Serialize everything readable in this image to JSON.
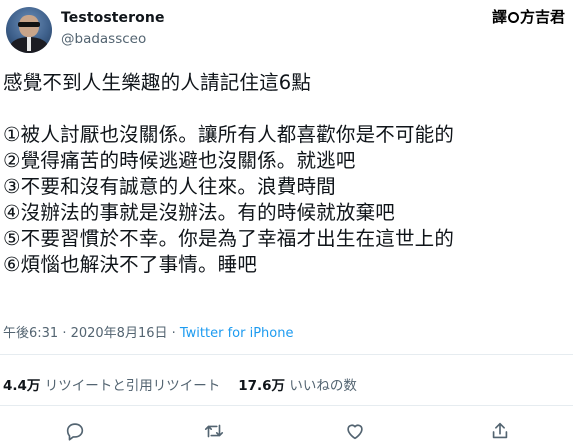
{
  "tweet": {
    "display_name": "Testosterone",
    "handle": "@badassceo",
    "watermark": {
      "left": "譯",
      "right": "方吉君"
    },
    "lines": [
      "感覺不到人生樂趣的人請記住這6點",
      "",
      "①被人討厭也沒關係。讓所有人都喜歡你是不可能的",
      "②覺得痛苦的時候逃避也沒關係。就逃吧",
      "③不要和沒有誠意的人往來。浪費時間",
      "④沒辦法的事就是沒辦法。有的時候就放棄吧",
      "⑤不要習慣於不幸。你是為了幸福才出生在這世上的",
      "⑥煩惱也解決不了事情。睡吧"
    ],
    "timestamp": "午後6:31 · 2020年8月16日 · ",
    "source": "Twitter for iPhone",
    "retweets_count": "4.4万",
    "retweets_label": "リツイートと引用リツイート",
    "likes_count": "17.6万",
    "likes_label": "いいねの数"
  },
  "colors": {
    "text": "#0f1419",
    "secondary": "#536471",
    "accent": "#1d9bf0",
    "divider": "#e6ecf0"
  },
  "icons": [
    "reply-icon",
    "retweet-icon",
    "like-icon",
    "share-icon"
  ]
}
